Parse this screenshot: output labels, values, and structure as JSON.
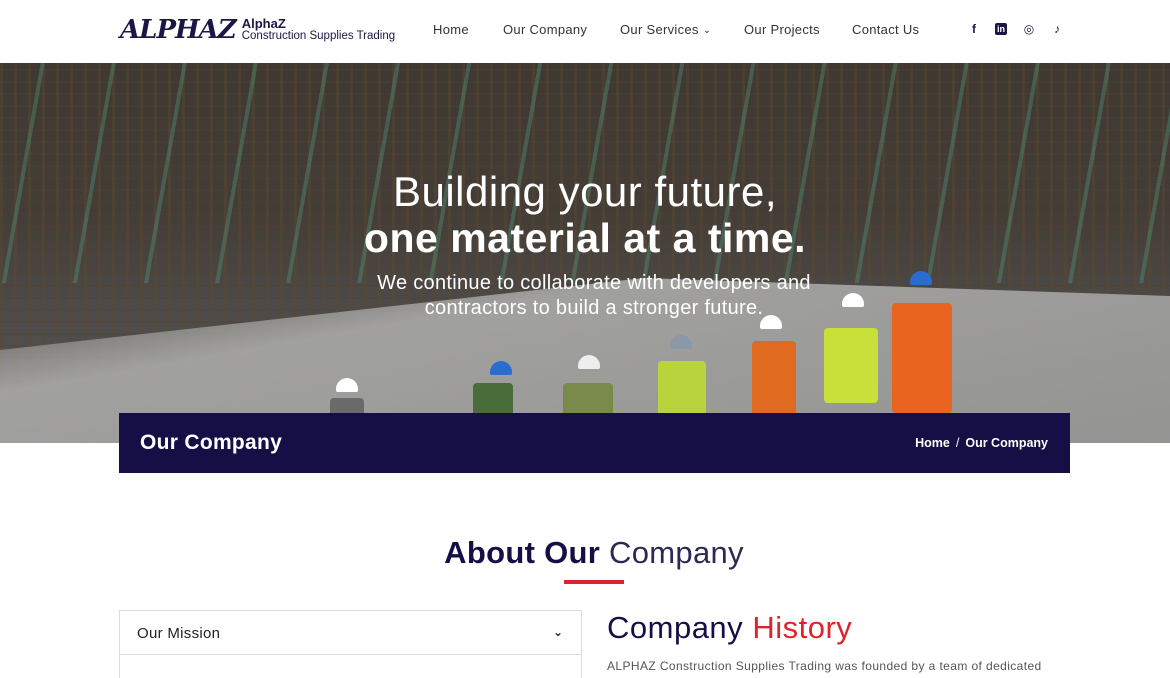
{
  "header": {
    "logo_mark": "ALPHAZ",
    "logo_name": "AlphaZ",
    "logo_sub": "Construction Supplies Trading",
    "nav": [
      {
        "label": "Home"
      },
      {
        "label": "Our Company"
      },
      {
        "label": "Our Services"
      },
      {
        "label": "Our Projects"
      },
      {
        "label": "Contact Us"
      }
    ],
    "social": [
      {
        "icon": "facebook-icon",
        "glyph": "f"
      },
      {
        "icon": "linkedin-icon",
        "glyph": "in"
      },
      {
        "icon": "instagram-icon",
        "glyph": "◎"
      },
      {
        "icon": "tiktok-icon",
        "glyph": "♪"
      }
    ]
  },
  "hero": {
    "line1": "Building your future,",
    "line2": "one material at a time.",
    "sub": "We continue to collaborate with developers and contractors to build a stronger future."
  },
  "title_bar": {
    "title": "Our Company",
    "breadcrumb": [
      "Home",
      "/",
      "Our Company"
    ]
  },
  "about": {
    "title_bold": "About Our",
    "title_light": "Company",
    "accordion_label": "Our Mission",
    "history_title": "Company",
    "history_accent": "History",
    "history_text": "ALPHAZ Construction Supplies Trading was founded by a team of dedicated"
  },
  "colors": {
    "navy": "#150f45",
    "accent_red": "#e0232b"
  }
}
